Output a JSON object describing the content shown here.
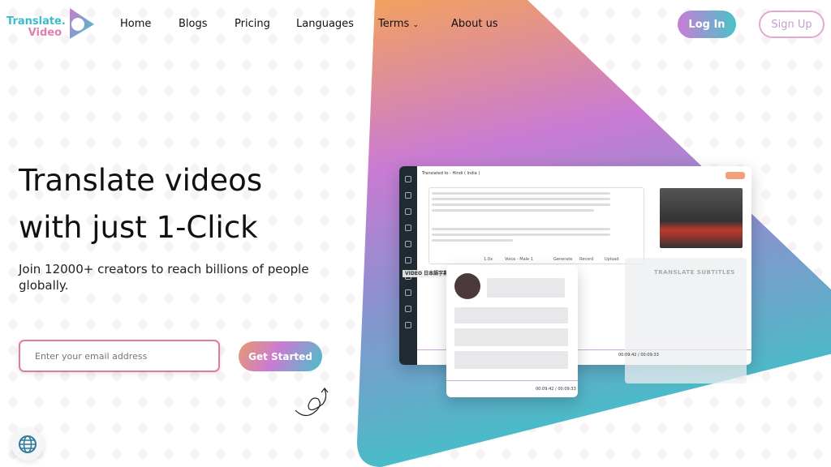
{
  "brand": {
    "line1": "Translate.",
    "line2": "Video"
  },
  "nav": {
    "items": [
      "Home",
      "Blogs",
      "Pricing",
      "Languages",
      "Terms",
      "About us"
    ],
    "login": "Log In",
    "signup": "Sign Up"
  },
  "hero": {
    "title_line1": "Translate videos",
    "title_line2": "with just 1-Click",
    "subtitle": "Join 12000+ creators to reach billions of people globally.",
    "email_placeholder": "Enter your email address",
    "cta": "Get Started"
  },
  "mockup": {
    "header": "Translated to - Hindi ( India )",
    "panel_title": "TRANSLATE SUBTITLES",
    "time": "00:09:42 / 00:09:33",
    "popup_time": "00:09:42 / 00:09:33",
    "voice": "Voice - Male 1",
    "generate": "Generate",
    "record": "Record",
    "upload": "Upload",
    "speed": "1.0x",
    "label_video": "VIDEO 日本語字幕"
  },
  "colors": {
    "orange": "#f3a060",
    "purple": "#c97bd3",
    "teal": "#3fc2c6",
    "pink_border": "#e07b9c"
  },
  "icons": [
    "logo-play-icon",
    "chevron-down-icon",
    "globe-icon",
    "arrow-doodle-icon"
  ]
}
